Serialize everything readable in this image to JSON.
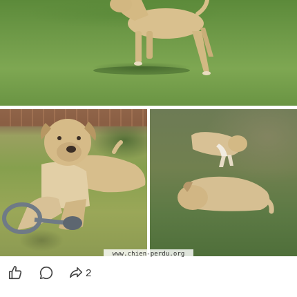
{
  "photos": {
    "top": {
      "icon": "dog-photo-standing"
    },
    "bottom_left": {
      "icon": "dog-photo-lying-with-rope-toy"
    },
    "bottom_right": {
      "icon": "dogs-photo-resting-on-grass"
    }
  },
  "watermark": {
    "text": "www.chien-perdu.org"
  },
  "actions": {
    "like": {
      "icon": "thumbs-up-icon"
    },
    "comment": {
      "icon": "comment-icon"
    },
    "share": {
      "icon": "share-icon",
      "count": "2"
    }
  }
}
